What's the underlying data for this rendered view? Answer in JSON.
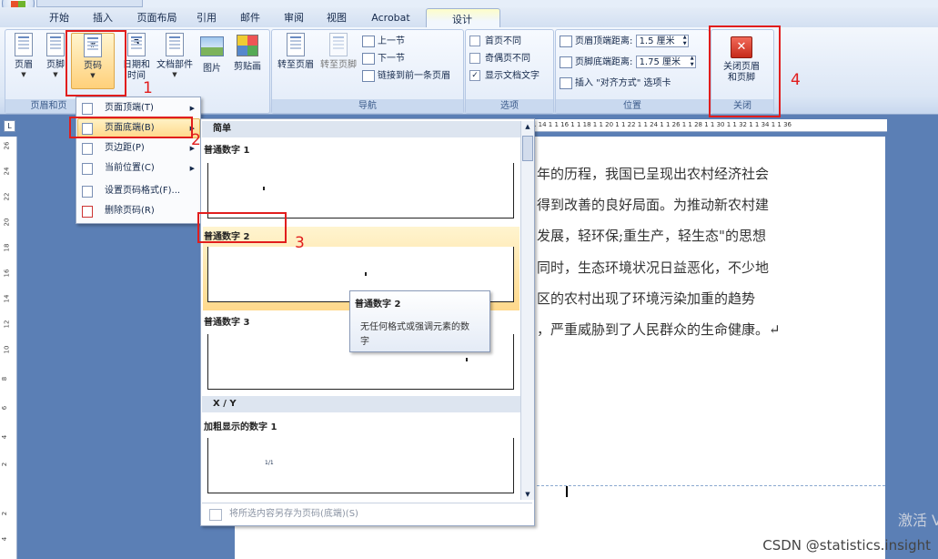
{
  "ribbon": {
    "tabs": [
      "开始",
      "插入",
      "页面布局",
      "引用",
      "邮件",
      "审阅",
      "视图",
      "Acrobat",
      "设计"
    ],
    "active_tab": "设计",
    "groups": {
      "header_footer": {
        "title": "页眉和页",
        "buttons": {
          "header": "页眉",
          "footer": "页脚",
          "page_number": "页码"
        }
      },
      "insert": {
        "buttons": {
          "datetime_1": "日期和",
          "datetime_2": "时间",
          "docparts": "文档部件",
          "picture": "图片",
          "clipart": "剪贴画"
        }
      },
      "navigation": {
        "title": "导航",
        "goto_header": "转至页眉",
        "goto_footer": "转至页脚",
        "prev": "上一节",
        "next": "下一节",
        "link_prev": "链接到前一条页眉"
      },
      "options": {
        "title": "选项",
        "first_page": "首页不同",
        "odd_even": "奇偶页不同",
        "show_text": "显示文档文字"
      },
      "position": {
        "title": "位置",
        "header_distance_label": "页眉顶端距离:",
        "header_distance_value": "1.5 厘米",
        "footer_distance_label": "页脚底端距离:",
        "footer_distance_value": "1.75 厘米",
        "insert_align_tab": "插入 \"对齐方式\" 选项卡"
      },
      "close": {
        "title": "关闭",
        "button_1": "关闭页眉",
        "button_2": "和页脚"
      }
    }
  },
  "menu": {
    "items": [
      {
        "label": "页面顶端(T)",
        "submenu": true
      },
      {
        "label": "页面底端(B)",
        "submenu": true
      },
      {
        "label": "页边距(P)",
        "submenu": true
      },
      {
        "label": "当前位置(C)",
        "submenu": true
      },
      {
        "label": "设置页码格式(F)...",
        "submenu": false
      },
      {
        "label": "删除页码(R)",
        "submenu": false
      }
    ]
  },
  "gallery": {
    "section_simple": "简单",
    "items": [
      {
        "label": "普通数字 1"
      },
      {
        "label": "普通数字 2"
      },
      {
        "label": "普通数字 3"
      }
    ],
    "section_xy": "X / Y",
    "item_bold": "加粗显示的数字 1",
    "bold_sample": "1/1",
    "footer": "将所选内容另存为页码(底端)(S)"
  },
  "tooltip": {
    "title": "普通数字 2",
    "body_1": "无任何格式或强调元素的数",
    "body_2": "字"
  },
  "document": {
    "lines": [
      "年的历程，我国已呈现出农村经济社会",
      "得到改善的良好局面。为推动新农村建",
      "发展，轻环保;重生产，轻生态\"的思想",
      "同时，生态环境状况日益恶化，不少地",
      "区的农村出现了环境污染加重的趋势",
      "，严重威胁到了人民群众的生命健康。↵"
    ]
  },
  "ruler_text": "1 14 1  1 16 1  1 18 1  1 20 1  1 22 1  1 24 1  1 26 1  1 28 1  1 30 1  1 32 1  1 34 1  1 36",
  "vruler_labels": [
    "26",
    "24",
    "22",
    "20",
    "18",
    "16",
    "14",
    "12",
    "10",
    "8",
    "6",
    "4",
    "2",
    "2",
    "4"
  ],
  "annotations": [
    "1",
    "2",
    "3",
    "4"
  ],
  "watermark": "CSDN @statistics.insight",
  "activate": "激活 V"
}
